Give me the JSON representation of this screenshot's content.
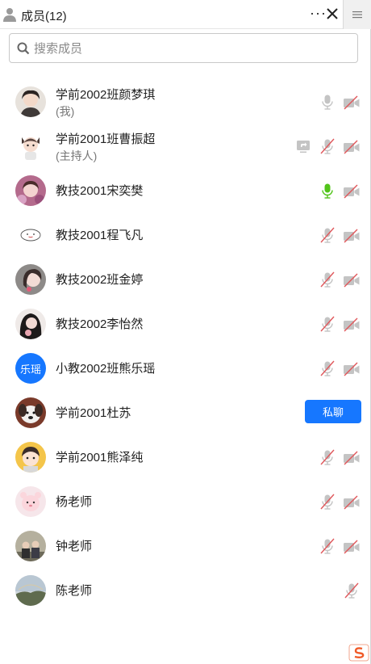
{
  "header": {
    "title": "成员(12)",
    "more_label": "···"
  },
  "search": {
    "placeholder": "搜索成员",
    "value": ""
  },
  "colors": {
    "accent": "#1677ff",
    "mic_active": "#52c41a",
    "muted_red": "#e0575b",
    "icon_gray": "#c4c4c4"
  },
  "members": [
    {
      "name": "学前2002班颜梦琪",
      "role": "(我)",
      "avatar": "photo",
      "mic": "idle",
      "camera": "off",
      "share": false
    },
    {
      "name": "学前2001班曹振超",
      "role": "(主持人)",
      "avatar": "cartoon",
      "mic": "muted",
      "camera": "off",
      "share": true
    },
    {
      "name": "教技2001宋奕樊",
      "role": "",
      "avatar": "photo",
      "mic": "active",
      "camera": "off",
      "share": false
    },
    {
      "name": "教技2001程飞凡",
      "role": "",
      "avatar": "sketch",
      "mic": "muted",
      "camera": "off",
      "share": false
    },
    {
      "name": "教技2002班金婷",
      "role": "",
      "avatar": "photo",
      "mic": "muted",
      "camera": "off",
      "share": false
    },
    {
      "name": "教技2002李怡然",
      "role": "",
      "avatar": "photo",
      "mic": "muted",
      "camera": "off",
      "share": false
    },
    {
      "name": "小教2002班熊乐瑶",
      "role": "",
      "avatar_text": "乐瑶",
      "mic": "muted",
      "camera": "off",
      "share": false
    },
    {
      "name": "学前2001杜苏",
      "role": "",
      "avatar": "dog",
      "action_label": "私聊"
    },
    {
      "name": "学前2001熊泽纯",
      "role": "",
      "avatar": "photo",
      "mic": "muted",
      "camera": "off",
      "share": false
    },
    {
      "name": "杨老师",
      "role": "",
      "avatar": "pink",
      "mic": "muted",
      "camera": "off",
      "share": false
    },
    {
      "name": "钟老师",
      "role": "",
      "avatar": "photo",
      "mic": "muted",
      "camera": "off",
      "share": false
    },
    {
      "name": "陈老师",
      "role": "",
      "avatar": "sky",
      "mic": "muted",
      "camera": "none",
      "share": false
    }
  ],
  "icons": [
    "person-icon",
    "more-icon",
    "close-icon",
    "menu-icon",
    "search-icon",
    "microphone-icon",
    "microphone-muted-icon",
    "camera-off-icon",
    "screen-share-icon",
    "sogou-logo-icon"
  ]
}
